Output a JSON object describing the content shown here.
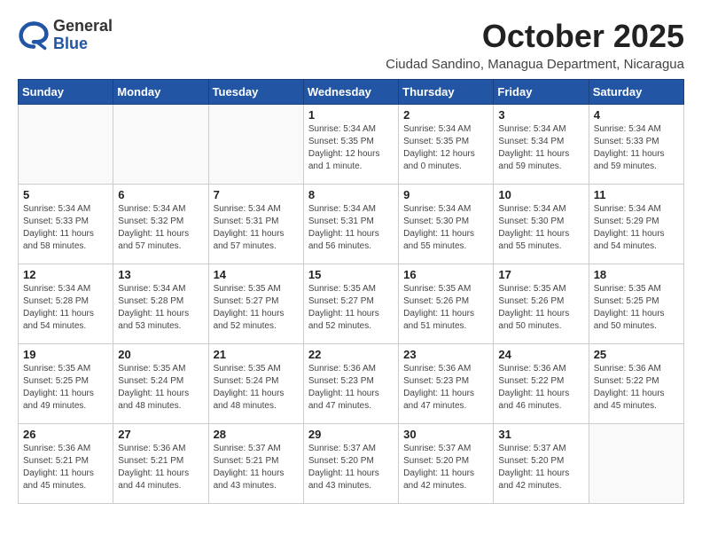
{
  "header": {
    "logo": {
      "general": "General",
      "blue": "Blue"
    },
    "month_year": "October 2025",
    "location": "Ciudad Sandino, Managua Department, Nicaragua"
  },
  "days_of_week": [
    "Sunday",
    "Monday",
    "Tuesday",
    "Wednesday",
    "Thursday",
    "Friday",
    "Saturday"
  ],
  "weeks": [
    [
      {
        "day": "",
        "info": ""
      },
      {
        "day": "",
        "info": ""
      },
      {
        "day": "",
        "info": ""
      },
      {
        "day": "1",
        "info": "Sunrise: 5:34 AM\nSunset: 5:35 PM\nDaylight: 12 hours\nand 1 minute."
      },
      {
        "day": "2",
        "info": "Sunrise: 5:34 AM\nSunset: 5:35 PM\nDaylight: 12 hours\nand 0 minutes."
      },
      {
        "day": "3",
        "info": "Sunrise: 5:34 AM\nSunset: 5:34 PM\nDaylight: 11 hours\nand 59 minutes."
      },
      {
        "day": "4",
        "info": "Sunrise: 5:34 AM\nSunset: 5:33 PM\nDaylight: 11 hours\nand 59 minutes."
      }
    ],
    [
      {
        "day": "5",
        "info": "Sunrise: 5:34 AM\nSunset: 5:33 PM\nDaylight: 11 hours\nand 58 minutes."
      },
      {
        "day": "6",
        "info": "Sunrise: 5:34 AM\nSunset: 5:32 PM\nDaylight: 11 hours\nand 57 minutes."
      },
      {
        "day": "7",
        "info": "Sunrise: 5:34 AM\nSunset: 5:31 PM\nDaylight: 11 hours\nand 57 minutes."
      },
      {
        "day": "8",
        "info": "Sunrise: 5:34 AM\nSunset: 5:31 PM\nDaylight: 11 hours\nand 56 minutes."
      },
      {
        "day": "9",
        "info": "Sunrise: 5:34 AM\nSunset: 5:30 PM\nDaylight: 11 hours\nand 55 minutes."
      },
      {
        "day": "10",
        "info": "Sunrise: 5:34 AM\nSunset: 5:30 PM\nDaylight: 11 hours\nand 55 minutes."
      },
      {
        "day": "11",
        "info": "Sunrise: 5:34 AM\nSunset: 5:29 PM\nDaylight: 11 hours\nand 54 minutes."
      }
    ],
    [
      {
        "day": "12",
        "info": "Sunrise: 5:34 AM\nSunset: 5:28 PM\nDaylight: 11 hours\nand 54 minutes."
      },
      {
        "day": "13",
        "info": "Sunrise: 5:34 AM\nSunset: 5:28 PM\nDaylight: 11 hours\nand 53 minutes."
      },
      {
        "day": "14",
        "info": "Sunrise: 5:35 AM\nSunset: 5:27 PM\nDaylight: 11 hours\nand 52 minutes."
      },
      {
        "day": "15",
        "info": "Sunrise: 5:35 AM\nSunset: 5:27 PM\nDaylight: 11 hours\nand 52 minutes."
      },
      {
        "day": "16",
        "info": "Sunrise: 5:35 AM\nSunset: 5:26 PM\nDaylight: 11 hours\nand 51 minutes."
      },
      {
        "day": "17",
        "info": "Sunrise: 5:35 AM\nSunset: 5:26 PM\nDaylight: 11 hours\nand 50 minutes."
      },
      {
        "day": "18",
        "info": "Sunrise: 5:35 AM\nSunset: 5:25 PM\nDaylight: 11 hours\nand 50 minutes."
      }
    ],
    [
      {
        "day": "19",
        "info": "Sunrise: 5:35 AM\nSunset: 5:25 PM\nDaylight: 11 hours\nand 49 minutes."
      },
      {
        "day": "20",
        "info": "Sunrise: 5:35 AM\nSunset: 5:24 PM\nDaylight: 11 hours\nand 48 minutes."
      },
      {
        "day": "21",
        "info": "Sunrise: 5:35 AM\nSunset: 5:24 PM\nDaylight: 11 hours\nand 48 minutes."
      },
      {
        "day": "22",
        "info": "Sunrise: 5:36 AM\nSunset: 5:23 PM\nDaylight: 11 hours\nand 47 minutes."
      },
      {
        "day": "23",
        "info": "Sunrise: 5:36 AM\nSunset: 5:23 PM\nDaylight: 11 hours\nand 47 minutes."
      },
      {
        "day": "24",
        "info": "Sunrise: 5:36 AM\nSunset: 5:22 PM\nDaylight: 11 hours\nand 46 minutes."
      },
      {
        "day": "25",
        "info": "Sunrise: 5:36 AM\nSunset: 5:22 PM\nDaylight: 11 hours\nand 45 minutes."
      }
    ],
    [
      {
        "day": "26",
        "info": "Sunrise: 5:36 AM\nSunset: 5:21 PM\nDaylight: 11 hours\nand 45 minutes."
      },
      {
        "day": "27",
        "info": "Sunrise: 5:36 AM\nSunset: 5:21 PM\nDaylight: 11 hours\nand 44 minutes."
      },
      {
        "day": "28",
        "info": "Sunrise: 5:37 AM\nSunset: 5:21 PM\nDaylight: 11 hours\nand 43 minutes."
      },
      {
        "day": "29",
        "info": "Sunrise: 5:37 AM\nSunset: 5:20 PM\nDaylight: 11 hours\nand 43 minutes."
      },
      {
        "day": "30",
        "info": "Sunrise: 5:37 AM\nSunset: 5:20 PM\nDaylight: 11 hours\nand 42 minutes."
      },
      {
        "day": "31",
        "info": "Sunrise: 5:37 AM\nSunset: 5:20 PM\nDaylight: 11 hours\nand 42 minutes."
      },
      {
        "day": "",
        "info": ""
      }
    ]
  ]
}
